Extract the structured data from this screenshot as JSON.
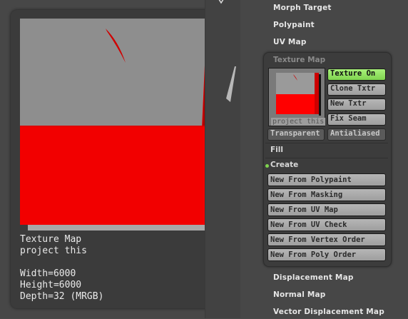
{
  "menu": {
    "items_top": [
      "Morph Target",
      "Polypaint",
      "UV Map"
    ],
    "items_bottom": [
      "Displacement Map",
      "Normal Map",
      "Vector Displacement Map"
    ]
  },
  "texture_map": {
    "header": "Texture Map",
    "thumbnail_caption": "project this",
    "buttons_right": [
      "Texture On",
      "Clone Txtr",
      "New Txtr",
      "Fix Seam"
    ],
    "toggles": [
      "Transparent",
      "Antialiased"
    ],
    "fill_label": "Fill",
    "create_label": "Create",
    "create_buttons": [
      "New From Polypaint",
      "New From Masking",
      "New From UV Map",
      "New From UV Check",
      "New From Vertex Order",
      "New From Poly Order"
    ],
    "active_color": "#7fd44f"
  },
  "preview": {
    "title": "Texture Map",
    "name": "project this",
    "width_text": "Width=6000",
    "height_text": "Height=6000",
    "depth_text": "Depth=32 (MRGB)",
    "colors": {
      "gray": "#8e8e8e",
      "red": "#ff0000",
      "dark_red": "#cc0000"
    }
  }
}
